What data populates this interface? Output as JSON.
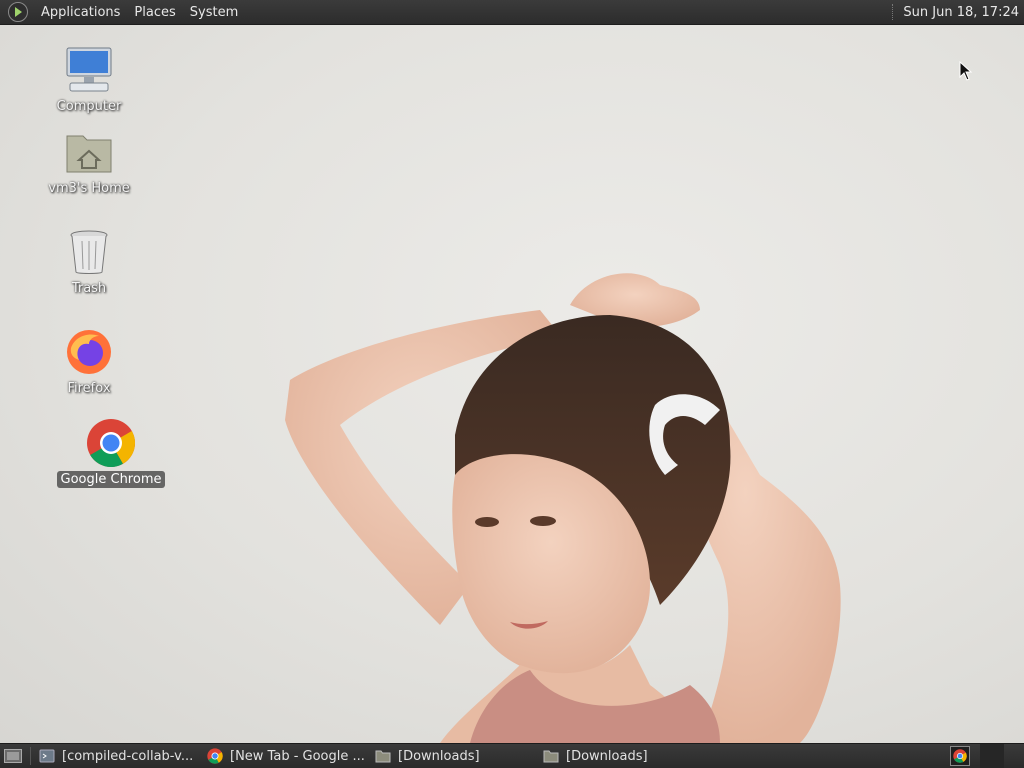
{
  "top_panel": {
    "menus": [
      "Applications",
      "Places",
      "System"
    ],
    "clock": "Sun Jun 18, 17:24"
  },
  "desktop": {
    "icons": [
      {
        "label": "Computer",
        "icon": "computer-icon"
      },
      {
        "label": "vm3's Home",
        "icon": "home-folder-icon"
      },
      {
        "label": "Trash",
        "icon": "trash-icon"
      },
      {
        "label": "Firefox",
        "icon": "firefox-icon"
      },
      {
        "label": "Google Chrome",
        "icon": "chrome-icon",
        "selected": true
      }
    ]
  },
  "taskbar": {
    "tasks": [
      {
        "label": "[compiled-collab-v...",
        "icon": "terminal-icon"
      },
      {
        "label": "[New Tab - Google ...",
        "icon": "chrome-icon"
      },
      {
        "label": "[Downloads]",
        "icon": "folder-icon"
      },
      {
        "label": "[Downloads]",
        "icon": "folder-icon"
      }
    ]
  },
  "colors": {
    "panel_bg": "#2f2f2f",
    "panel_text": "#e8e8e8",
    "selection_bg": "#4a4a4a"
  }
}
